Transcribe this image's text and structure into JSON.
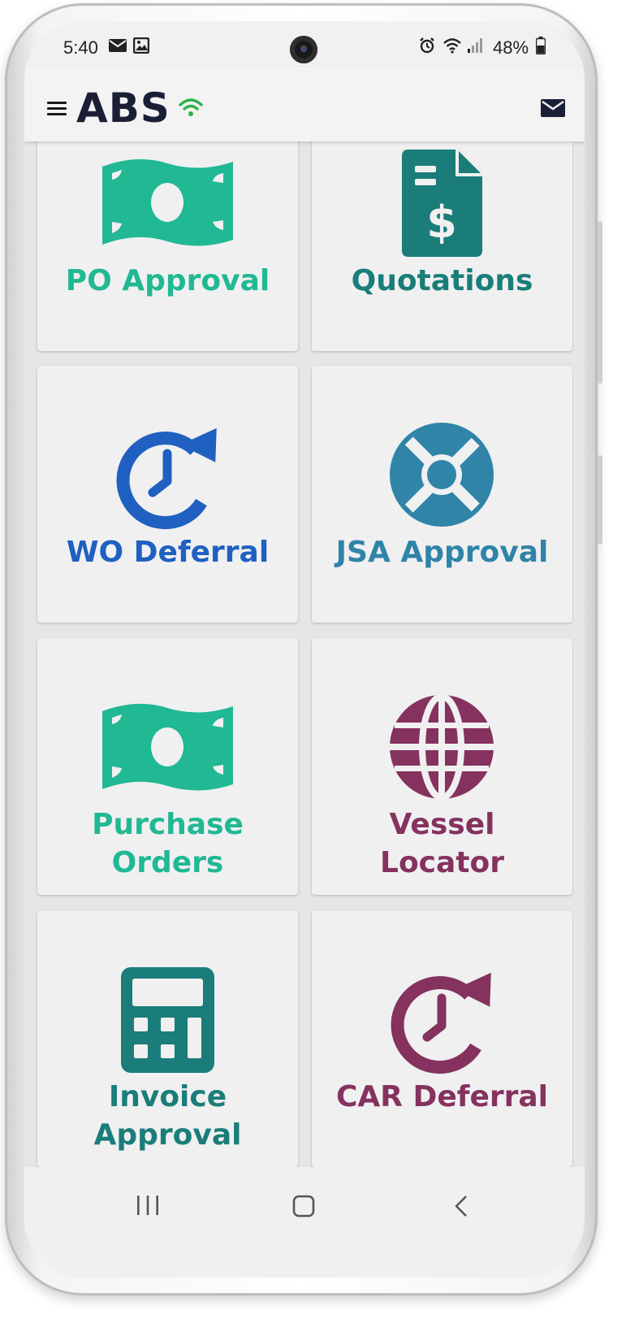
{
  "status_bar": {
    "time": "5:40",
    "battery": "48%",
    "icons": [
      "mail-icon",
      "image-icon",
      "alarm-icon",
      "wifi-icon",
      "signal-icon",
      "battery-icon"
    ]
  },
  "header": {
    "title": "ABS",
    "icons": [
      "menu-icon",
      "wifi-icon",
      "mail-icon"
    ]
  },
  "tiles": [
    {
      "id": "po-approval",
      "label": "PO Approval",
      "icon": "money-bill-icon",
      "color": "#21b894"
    },
    {
      "id": "quotations",
      "label": "Quotations",
      "icon": "invoice-dollar-icon",
      "color": "#1a7d79"
    },
    {
      "id": "wo-deferral",
      "label": "WO Deferral",
      "icon": "clock-rotate-icon",
      "color": "#1f60c0"
    },
    {
      "id": "jsa-approval",
      "label": "JSA Approval",
      "icon": "life-ring-icon",
      "color": "#2f84a8"
    },
    {
      "id": "purchase-orders",
      "label_lines": [
        "Purchase",
        "Orders"
      ],
      "icon": "money-bill-icon",
      "color": "#21b894"
    },
    {
      "id": "vessel-locator",
      "label_lines": [
        "Vessel",
        "Locator"
      ],
      "icon": "globe-icon",
      "color": "#85325f"
    },
    {
      "id": "invoice-approval",
      "label_lines": [
        "Invoice",
        "Approval"
      ],
      "icon": "calculator-icon",
      "color": "#1a7d79"
    },
    {
      "id": "car-deferral",
      "label": "CAR Deferral",
      "icon": "clock-rotate-icon",
      "color": "#85325f"
    }
  ],
  "nav_bar": {
    "buttons": [
      "recent-apps-icon",
      "home-icon",
      "back-icon"
    ]
  },
  "colors": {
    "accent_green": "#21b894",
    "teal": "#1a7d79",
    "blue": "#1f60c0",
    "steel_blue": "#2f84a8",
    "plum": "#85325f",
    "title_navy": "#1b1f36",
    "wifi_green": "#2bb24c"
  }
}
